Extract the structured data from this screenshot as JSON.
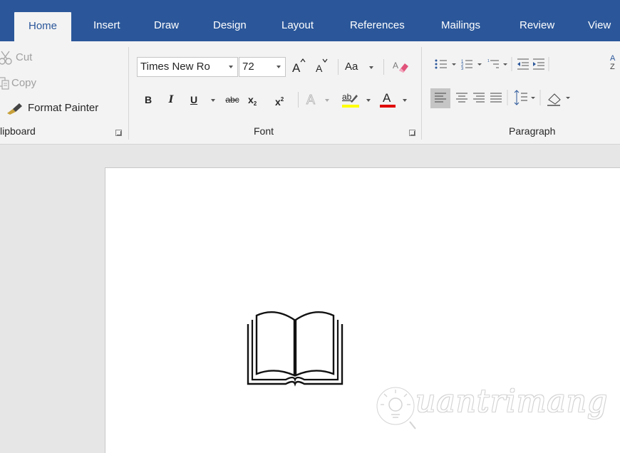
{
  "tabs": [
    {
      "label": "Home",
      "active": true
    },
    {
      "label": "Insert"
    },
    {
      "label": "Draw"
    },
    {
      "label": "Design"
    },
    {
      "label": "Layout"
    },
    {
      "label": "References"
    },
    {
      "label": "Mailings"
    },
    {
      "label": "Review"
    },
    {
      "label": "View"
    }
  ],
  "clipboard": {
    "cut_label": "Cut",
    "copy_label": "Copy",
    "format_painter_label": "Format Painter",
    "group_label": "lipboard"
  },
  "font": {
    "font_name": "Times New Ro",
    "font_size": "72",
    "change_case_label": "Aa",
    "bold_label": "B",
    "italic_label": "I",
    "underline_label": "U",
    "strike_label": "abc",
    "subscript_label": "x",
    "subscript_mark": "2",
    "superscript_label": "x",
    "superscript_mark": "2",
    "text_effects_label": "A",
    "highlight_label": "ab",
    "font_color_label": "A",
    "group_label": "Font"
  },
  "paragraph": {
    "group_label": "Paragraph",
    "sort_label": "A"
  },
  "colors": {
    "tab_bar": "#2b579a",
    "highlight": "#ffff00",
    "font_color": "#e00000"
  },
  "watermark": {
    "text": "uantrimang"
  }
}
